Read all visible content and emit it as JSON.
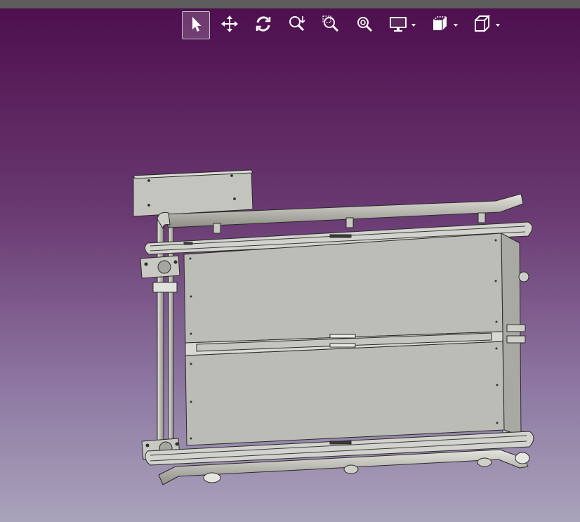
{
  "window": {
    "app": "3D CAD viewer"
  },
  "colors": {
    "viewport_top": "#4e0f4e",
    "viewport_bottom": "#a9a3bb",
    "model_fill": "#bdbdb7",
    "model_edge": "#2a2a2a",
    "icon": "#ffffff"
  },
  "toolbar": {
    "tools": [
      {
        "id": "select",
        "icon": "arrow-cursor-icon",
        "active": true
      },
      {
        "id": "pan",
        "icon": "move-arrows-icon"
      },
      {
        "id": "rotate",
        "icon": "rotate-icon"
      },
      {
        "id": "zoom",
        "icon": "zoom-icon"
      },
      {
        "id": "zoom-window",
        "icon": "zoom-window-icon"
      },
      {
        "id": "zoom-fit",
        "icon": "zoom-fit-icon"
      },
      {
        "id": "display-mode",
        "icon": "monitor-icon",
        "has_dropdown": true
      },
      {
        "id": "section-view",
        "icon": "section-cube-icon",
        "has_dropdown": true
      },
      {
        "id": "standard-views",
        "icon": "cube-icon",
        "has_dropdown": true
      }
    ]
  }
}
